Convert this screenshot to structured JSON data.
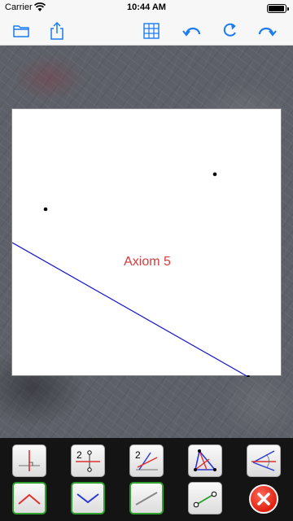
{
  "status_bar": {
    "carrier": "Carrier",
    "time": "10:44 AM",
    "battery_level": 0.85
  },
  "toolbar": {
    "accent_color": "#1a7cf0",
    "left_icons": [
      "folder-icon",
      "share-icon"
    ],
    "right_icons": [
      "grid-icon",
      "undo-icon",
      "redo-icon",
      "forward-icon"
    ]
  },
  "canvas": {
    "label": "Axiom 5",
    "label_color": "#d63a3a",
    "line_color": "#1414d0"
  },
  "tools": {
    "row1": [
      "perpendicular-tool-icon",
      "axiom-two-points-icon",
      "axiom-two-angle-icon",
      "triangle-tool-icon",
      "angle-bisector-icon"
    ],
    "row2": [
      "valley-fold-red-icon",
      "valley-fold-blue-icon",
      "line-grey-icon",
      "segment-green-icon",
      "close-icon"
    ],
    "selected_border_color": "#2e9e2e"
  }
}
